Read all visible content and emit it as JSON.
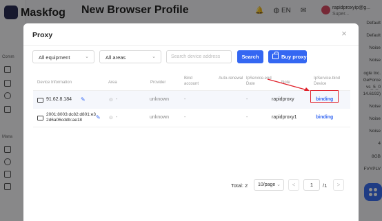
{
  "background": {
    "app_name": "Maskfog",
    "page_title": "New Browser Profile",
    "language": "EN",
    "user_name": "rapidproxyip@g...",
    "user_role": "Super...",
    "sidebar_labels": [
      "Comm",
      "Mana"
    ],
    "right_values": [
      "Default",
      "Default",
      "Noise",
      "Noise",
      "ogle Inc.",
      "GeForce",
      "vs_5_0",
      "14.6192)",
      "Noise",
      "Noise",
      "Noise",
      "4",
      "8GB",
      "FVYPLV"
    ]
  },
  "modal": {
    "title": "Proxy",
    "close_label": "×",
    "filters": {
      "equipment": "All equipment",
      "area": "All areas",
      "search_placeholder": "Search device address",
      "search_button": "Search",
      "buy_button": "Buy proxy"
    },
    "columns": [
      "Device Information",
      "Area",
      "Provider",
      "Bind account",
      "Auto-renewal",
      "IpService.end Date",
      "Note",
      "IpService.bind Device"
    ],
    "rows": [
      {
        "device": "91.62.8.184",
        "area": "-",
        "provider": "unknown",
        "bind": "-",
        "renewal": "-",
        "end_date": "-",
        "note": "rapidproxy",
        "action": "binding"
      },
      {
        "device": "2001:8003:dc82:d801:e3 2d6a06cddb:ae18",
        "area": "-",
        "provider": "unknown",
        "bind": "-",
        "renewal": "-",
        "end_date": "-",
        "note": "rapidproxy1",
        "action": "binding"
      }
    ],
    "pagination": {
      "total": "Total: 2",
      "page_size": "10/page",
      "prev": "<",
      "next": ">",
      "current_page": "1",
      "of_pages": "/1"
    }
  },
  "colors": {
    "primary": "#3467f2",
    "highlight": "#e0202a"
  }
}
